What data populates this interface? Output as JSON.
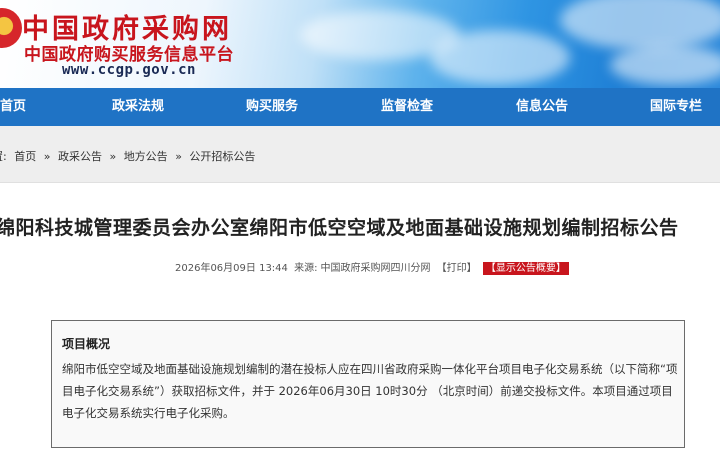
{
  "header": {
    "site_name": "中国政府采购网",
    "site_full_name": "中国政府购买服务信息平台",
    "site_url": "www.ccgp.gov.cn"
  },
  "nav": {
    "items": [
      "首页",
      "政采法规",
      "购买服务",
      "监督检查",
      "信息公告",
      "国际专栏"
    ]
  },
  "breadcrumb": {
    "prefix": "置:",
    "items": [
      "首页",
      "政采公告",
      "地方公告",
      "公开招标公告"
    ],
    "separator": "»"
  },
  "article": {
    "title": "绵阳科技城管理委员会办公室绵阳市低空空域及地面基础设施规划编制招标公告",
    "datetime": "2026年06月09日 13:44",
    "source_label": "来源:",
    "source": "中国政府采购网四川分网",
    "print_label": "【打印】",
    "summary_label": "【显示公告概要】"
  },
  "overview": {
    "heading": "项目概况",
    "body": "绵阳市低空空域及地面基础设施规划编制的潜在投标人应在四川省政府采购一体化平台项目电子化交易系统（以下简称“项目电子化交易系统”）获取招标文件，并于 2026年06月30日 10时30分 （北京时间）前递交投标文件。本项目通过项目电子化交易系统实行电子化采购。"
  },
  "colors": {
    "nav_bg": "#1f73c5",
    "logo_red": "#c8151d",
    "breadcrumb_bg": "#eeeeee"
  }
}
